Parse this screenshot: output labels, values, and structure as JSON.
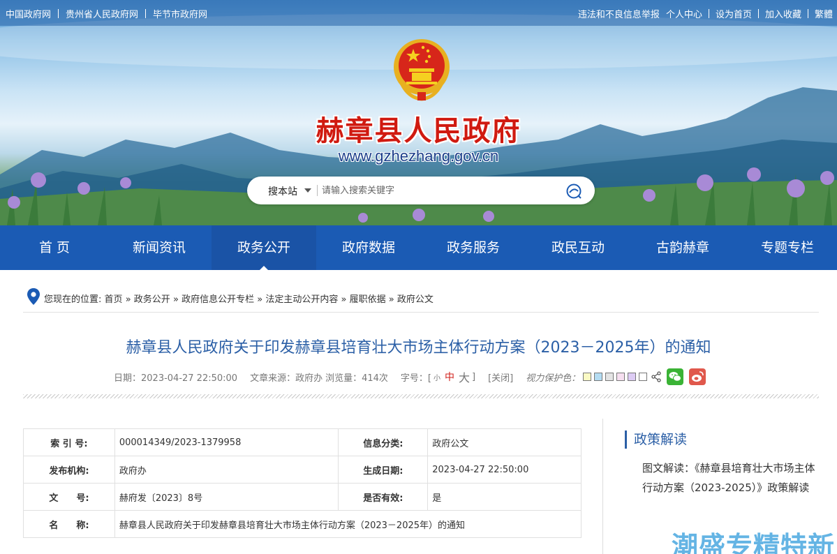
{
  "topbar": {
    "left_links": [
      "中国政府网",
      "贵州省人民政府网",
      "毕节市政府网"
    ],
    "right_links": [
      "违法和不良信息举报",
      "个人中心",
      "设为首页",
      "加入收藏",
      "繁體"
    ]
  },
  "header": {
    "title": "赫章县人民政府",
    "url": "www.gzhezhang.gov.cn"
  },
  "search": {
    "scope": "搜本站",
    "placeholder": "请输入搜索关键字"
  },
  "nav": {
    "items": [
      "首 页",
      "新闻资讯",
      "政务公开",
      "政府数据",
      "政务服务",
      "政民互动",
      "古韵赫章",
      "专题专栏"
    ],
    "active_index": 2
  },
  "breadcrumb": {
    "prefix": "您现在的位置:",
    "items": [
      "首页",
      "政务公开",
      "政府信息公开专栏",
      "法定主动公开内容",
      "履职依据",
      "政府公文"
    ],
    "separator": "»"
  },
  "article": {
    "title": "赫章县人民政府关于印发赫章县培育壮大市场主体行动方案（2023－2025年）的通知",
    "meta": {
      "date": "日期：2023-04-27 22:50:00",
      "source": "文章来源：政府办",
      "views": "浏览量：414次",
      "font_label": "字号：[",
      "font_small": "小",
      "font_mid": "中",
      "font_big": "大",
      "font_close": "]",
      "close": "[关闭]",
      "eye_label": "视力保护色："
    },
    "eye_colors": [
      "#fafac4",
      "#b4dcf2",
      "#e4e4e4",
      "#f6dff0",
      "#ddccf4",
      "#ffffff"
    ]
  },
  "info_table": {
    "rows": [
      {
        "k1": "索 引 号:",
        "v1": "000014349/2023-1379958",
        "k2": "信息分类:",
        "v2": "政府公文"
      },
      {
        "k1": "发布机构:",
        "v1": "政府办",
        "k2": "生成日期:",
        "v2": "2023-04-27 22:50:00"
      },
      {
        "k1": "文　　号:",
        "v1": "赫府发〔2023〕8号",
        "k2": "是否有效:",
        "v2": "是"
      }
    ],
    "name_label": "名　　称:",
    "name_value": "赫章县人民政府关于印发赫章县培育壮大市场主体行动方案（2023－2025年）的通知"
  },
  "sidebar": {
    "title": "政策解读",
    "item": "图文解读：《赫章县培育壮大市场主体行动方案（2023-2025）》政策解读"
  },
  "watermark": "潮盛专精特新"
}
